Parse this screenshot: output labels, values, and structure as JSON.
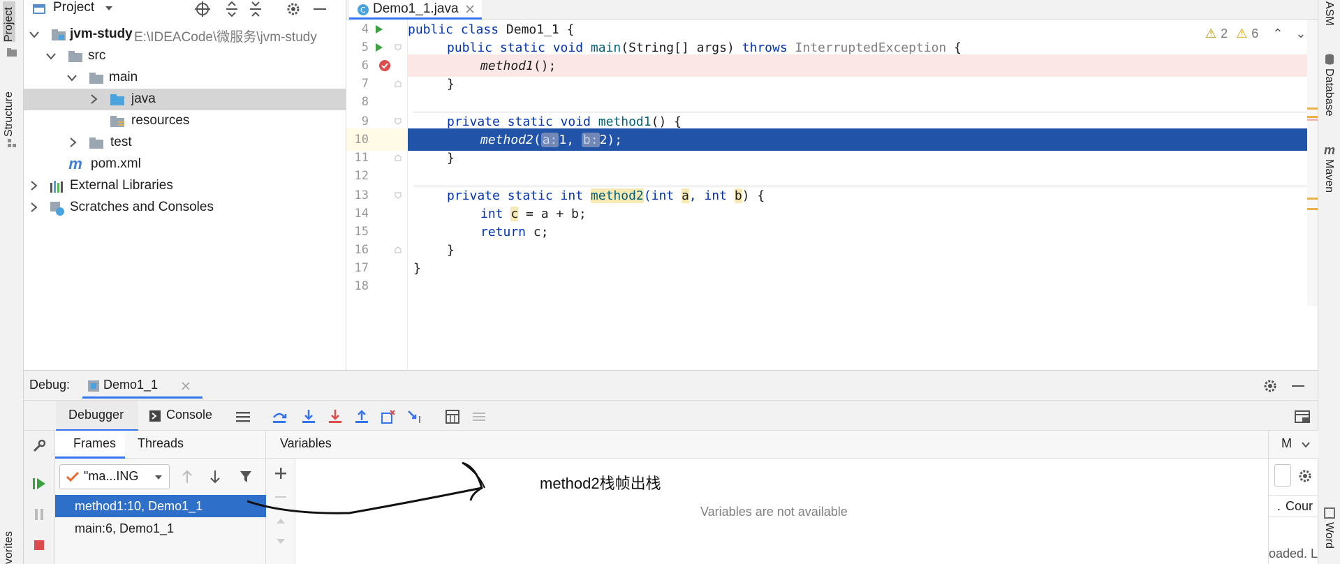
{
  "left_strip": {
    "project_tab": "Project",
    "structure_tab": "Structure",
    "favorites_tab": "vorites"
  },
  "right_strip": {
    "asm_tab": "ASM",
    "database_tab": "Database",
    "maven_tab": "Maven",
    "word_tab": "Word"
  },
  "project": {
    "title": "Project",
    "tree": [
      {
        "label": "jvm-study",
        "path": "E:\\IDEACode\\微服务\\jvm-study"
      },
      {
        "label": "src"
      },
      {
        "label": "main"
      },
      {
        "label": "java"
      },
      {
        "label": "resources"
      },
      {
        "label": "test"
      },
      {
        "label": "pom.xml"
      },
      {
        "label": "External Libraries"
      },
      {
        "label": "Scratches and Consoles"
      }
    ]
  },
  "editor": {
    "tab_label": "Demo1_1.java",
    "inspections": {
      "weak_warnings": "2",
      "warnings": "6"
    },
    "lines": [
      {
        "num": "4"
      },
      {
        "num": "5"
      },
      {
        "num": "6"
      },
      {
        "num": "7"
      },
      {
        "num": "8"
      },
      {
        "num": "9"
      },
      {
        "num": "10"
      },
      {
        "num": "11"
      },
      {
        "num": "12"
      },
      {
        "num": "13"
      },
      {
        "num": "14"
      },
      {
        "num": "15"
      },
      {
        "num": "16"
      },
      {
        "num": "17"
      },
      {
        "num": "18"
      }
    ],
    "code": {
      "l4": [
        "public class ",
        "Demo1_1",
        " {"
      ],
      "l5": [
        "public static void ",
        "main",
        "(String[] args) ",
        "throws ",
        "InterruptedException",
        " {"
      ],
      "l6": [
        "method1",
        "();"
      ],
      "l7": "}",
      "l9": [
        "private static void ",
        "method1",
        "() {"
      ],
      "l10": [
        "method2",
        "(",
        "a:",
        "1, ",
        "b:",
        "2);"
      ],
      "l11": "}",
      "l13": [
        "private static int ",
        "method2",
        "(int ",
        "a",
        ", int ",
        "b",
        ") {"
      ],
      "l14": [
        "int ",
        "c",
        " = a + b;"
      ],
      "l15": [
        "return ",
        "c;"
      ],
      "l16": "}",
      "l17": "}"
    }
  },
  "debug": {
    "label": "Debug:",
    "session_tab": "Demo1_1",
    "tabs": {
      "debugger": "Debugger",
      "console": "Console"
    },
    "frames_tab": "Frames",
    "threads_tab": "Threads",
    "thread_selector": "\"ma...ING",
    "frames": [
      "method1:10, Demo1_1",
      "main:6, Demo1_1"
    ],
    "variables_title": "Variables",
    "annotation": "method2栈帧出栈",
    "empty_message": "Variables are not available",
    "watches_header": "M",
    "watches_col": "Cour",
    "watches_status": "oaded. L",
    "watches_dot": "."
  },
  "colors": {
    "selection_blue": "#2154a8",
    "breakpoint_line": "#fbe8e6",
    "keyword": "#0033b3",
    "function": "#00627a"
  }
}
